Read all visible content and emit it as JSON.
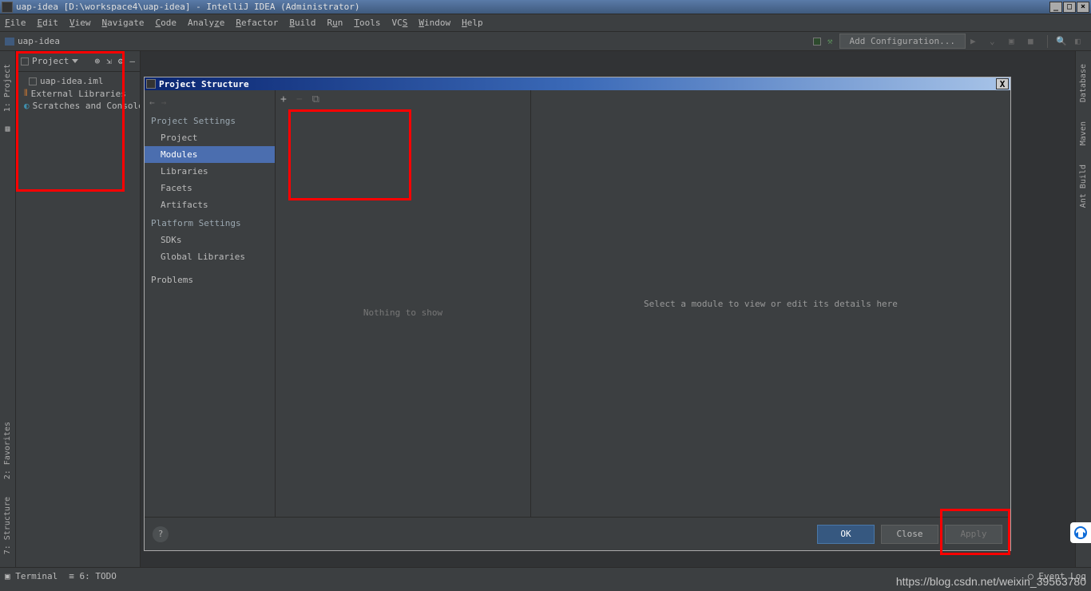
{
  "window": {
    "title": "uap-idea [D:\\workspace4\\uap-idea] - IntelliJ IDEA (Administrator)"
  },
  "menubar": [
    "File",
    "Edit",
    "View",
    "Navigate",
    "Code",
    "Analyze",
    "Refactor",
    "Build",
    "Run",
    "Tools",
    "VCS",
    "Window",
    "Help"
  ],
  "breadcrumb": {
    "root": "uap-idea"
  },
  "run_config": {
    "placeholder": "Add Configuration..."
  },
  "left_tabs": [
    "1: Project"
  ],
  "left_tabs_lower": [
    "2: Favorites",
    "7: Structure"
  ],
  "right_tabs": [
    "Database",
    "Maven",
    "Ant Build"
  ],
  "project_pane": {
    "title": "Project",
    "items": [
      {
        "label": "uap-idea.iml"
      },
      {
        "label": "External Libraries"
      },
      {
        "label": "Scratches and Consoles"
      }
    ]
  },
  "dialog": {
    "title": "Project Structure",
    "sections": {
      "project_settings": {
        "heading": "Project Settings",
        "items": [
          "Project",
          "Modules",
          "Libraries",
          "Facets",
          "Artifacts"
        ],
        "selected": "Modules"
      },
      "platform_settings": {
        "heading": "Platform Settings",
        "items": [
          "SDKs",
          "Global Libraries"
        ]
      },
      "problems": "Problems"
    },
    "mid": {
      "empty_text": "Nothing to show"
    },
    "right": {
      "empty_text": "Select a module to view or edit its details here"
    },
    "buttons": {
      "ok": "OK",
      "close": "Close",
      "apply": "Apply"
    }
  },
  "bottom_bar": {
    "terminal": "Terminal",
    "todo": "6: TODO",
    "event_log": "Event Log"
  },
  "watermark": "https://blog.csdn.net/weixin_39563780"
}
